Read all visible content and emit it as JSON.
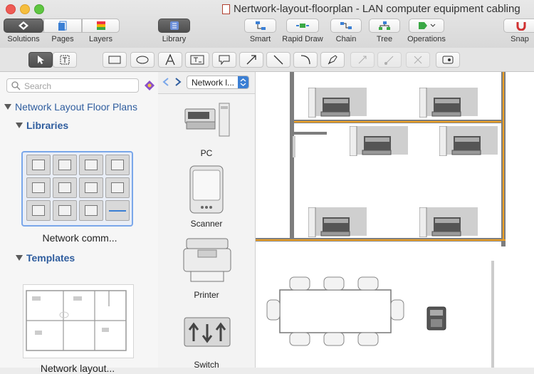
{
  "window": {
    "title": "Nertwork-layout-floorplan - LAN computer equipment cabling"
  },
  "toolbar": {
    "solutions": "Solutions",
    "pages": "Pages",
    "layers": "Layers",
    "library": "Library",
    "smart": "Smart",
    "rapid_draw": "Rapid Draw",
    "chain": "Chain",
    "tree": "Tree",
    "operations": "Operations",
    "snap": "Snap"
  },
  "search": {
    "placeholder": "Search"
  },
  "left_panel": {
    "section_title": "Network Layout Floor Plans",
    "libraries_label": "Libraries",
    "library_item": "Network comm...",
    "templates_label": "Templates",
    "template_item": "Network layout..."
  },
  "library_panel": {
    "selector": "Network l...",
    "items": [
      "PC",
      "Scanner",
      "Printer",
      "Switch"
    ]
  },
  "colors": {
    "accent": "#2f5d9e",
    "selection": "#7aa7ea",
    "wall": "#7d7d7d",
    "cable": "#f0a020"
  }
}
